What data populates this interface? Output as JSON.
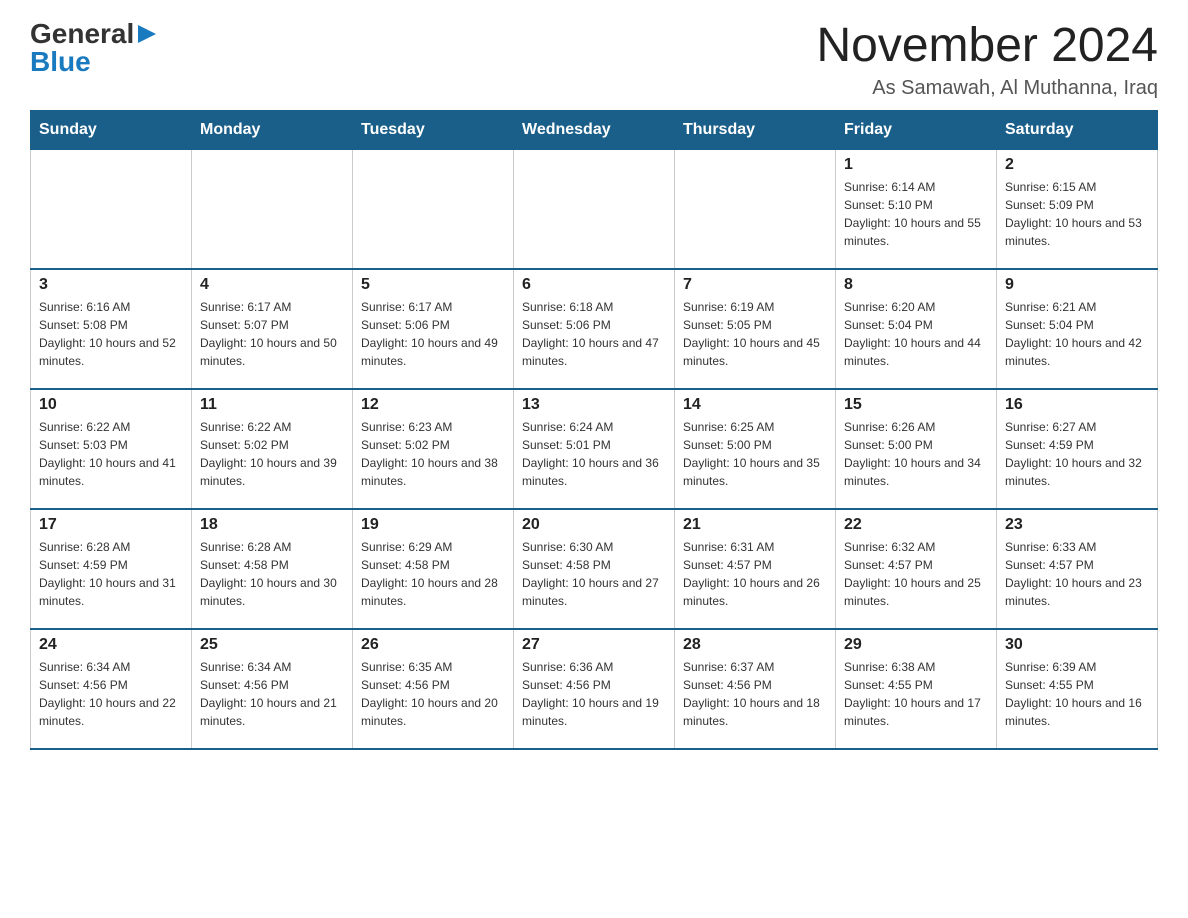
{
  "logo": {
    "general": "General",
    "blue": "Blue"
  },
  "title": "November 2024",
  "subtitle": "As Samawah, Al Muthanna, Iraq",
  "days_of_week": [
    "Sunday",
    "Monday",
    "Tuesday",
    "Wednesday",
    "Thursday",
    "Friday",
    "Saturday"
  ],
  "weeks": [
    [
      {
        "day": "",
        "sunrise": "",
        "sunset": "",
        "daylight": ""
      },
      {
        "day": "",
        "sunrise": "",
        "sunset": "",
        "daylight": ""
      },
      {
        "day": "",
        "sunrise": "",
        "sunset": "",
        "daylight": ""
      },
      {
        "day": "",
        "sunrise": "",
        "sunset": "",
        "daylight": ""
      },
      {
        "day": "",
        "sunrise": "",
        "sunset": "",
        "daylight": ""
      },
      {
        "day": "1",
        "sunrise": "Sunrise: 6:14 AM",
        "sunset": "Sunset: 5:10 PM",
        "daylight": "Daylight: 10 hours and 55 minutes."
      },
      {
        "day": "2",
        "sunrise": "Sunrise: 6:15 AM",
        "sunset": "Sunset: 5:09 PM",
        "daylight": "Daylight: 10 hours and 53 minutes."
      }
    ],
    [
      {
        "day": "3",
        "sunrise": "Sunrise: 6:16 AM",
        "sunset": "Sunset: 5:08 PM",
        "daylight": "Daylight: 10 hours and 52 minutes."
      },
      {
        "day": "4",
        "sunrise": "Sunrise: 6:17 AM",
        "sunset": "Sunset: 5:07 PM",
        "daylight": "Daylight: 10 hours and 50 minutes."
      },
      {
        "day": "5",
        "sunrise": "Sunrise: 6:17 AM",
        "sunset": "Sunset: 5:06 PM",
        "daylight": "Daylight: 10 hours and 49 minutes."
      },
      {
        "day": "6",
        "sunrise": "Sunrise: 6:18 AM",
        "sunset": "Sunset: 5:06 PM",
        "daylight": "Daylight: 10 hours and 47 minutes."
      },
      {
        "day": "7",
        "sunrise": "Sunrise: 6:19 AM",
        "sunset": "Sunset: 5:05 PM",
        "daylight": "Daylight: 10 hours and 45 minutes."
      },
      {
        "day": "8",
        "sunrise": "Sunrise: 6:20 AM",
        "sunset": "Sunset: 5:04 PM",
        "daylight": "Daylight: 10 hours and 44 minutes."
      },
      {
        "day": "9",
        "sunrise": "Sunrise: 6:21 AM",
        "sunset": "Sunset: 5:04 PM",
        "daylight": "Daylight: 10 hours and 42 minutes."
      }
    ],
    [
      {
        "day": "10",
        "sunrise": "Sunrise: 6:22 AM",
        "sunset": "Sunset: 5:03 PM",
        "daylight": "Daylight: 10 hours and 41 minutes."
      },
      {
        "day": "11",
        "sunrise": "Sunrise: 6:22 AM",
        "sunset": "Sunset: 5:02 PM",
        "daylight": "Daylight: 10 hours and 39 minutes."
      },
      {
        "day": "12",
        "sunrise": "Sunrise: 6:23 AM",
        "sunset": "Sunset: 5:02 PM",
        "daylight": "Daylight: 10 hours and 38 minutes."
      },
      {
        "day": "13",
        "sunrise": "Sunrise: 6:24 AM",
        "sunset": "Sunset: 5:01 PM",
        "daylight": "Daylight: 10 hours and 36 minutes."
      },
      {
        "day": "14",
        "sunrise": "Sunrise: 6:25 AM",
        "sunset": "Sunset: 5:00 PM",
        "daylight": "Daylight: 10 hours and 35 minutes."
      },
      {
        "day": "15",
        "sunrise": "Sunrise: 6:26 AM",
        "sunset": "Sunset: 5:00 PM",
        "daylight": "Daylight: 10 hours and 34 minutes."
      },
      {
        "day": "16",
        "sunrise": "Sunrise: 6:27 AM",
        "sunset": "Sunset: 4:59 PM",
        "daylight": "Daylight: 10 hours and 32 minutes."
      }
    ],
    [
      {
        "day": "17",
        "sunrise": "Sunrise: 6:28 AM",
        "sunset": "Sunset: 4:59 PM",
        "daylight": "Daylight: 10 hours and 31 minutes."
      },
      {
        "day": "18",
        "sunrise": "Sunrise: 6:28 AM",
        "sunset": "Sunset: 4:58 PM",
        "daylight": "Daylight: 10 hours and 30 minutes."
      },
      {
        "day": "19",
        "sunrise": "Sunrise: 6:29 AM",
        "sunset": "Sunset: 4:58 PM",
        "daylight": "Daylight: 10 hours and 28 minutes."
      },
      {
        "day": "20",
        "sunrise": "Sunrise: 6:30 AM",
        "sunset": "Sunset: 4:58 PM",
        "daylight": "Daylight: 10 hours and 27 minutes."
      },
      {
        "day": "21",
        "sunrise": "Sunrise: 6:31 AM",
        "sunset": "Sunset: 4:57 PM",
        "daylight": "Daylight: 10 hours and 26 minutes."
      },
      {
        "day": "22",
        "sunrise": "Sunrise: 6:32 AM",
        "sunset": "Sunset: 4:57 PM",
        "daylight": "Daylight: 10 hours and 25 minutes."
      },
      {
        "day": "23",
        "sunrise": "Sunrise: 6:33 AM",
        "sunset": "Sunset: 4:57 PM",
        "daylight": "Daylight: 10 hours and 23 minutes."
      }
    ],
    [
      {
        "day": "24",
        "sunrise": "Sunrise: 6:34 AM",
        "sunset": "Sunset: 4:56 PM",
        "daylight": "Daylight: 10 hours and 22 minutes."
      },
      {
        "day": "25",
        "sunrise": "Sunrise: 6:34 AM",
        "sunset": "Sunset: 4:56 PM",
        "daylight": "Daylight: 10 hours and 21 minutes."
      },
      {
        "day": "26",
        "sunrise": "Sunrise: 6:35 AM",
        "sunset": "Sunset: 4:56 PM",
        "daylight": "Daylight: 10 hours and 20 minutes."
      },
      {
        "day": "27",
        "sunrise": "Sunrise: 6:36 AM",
        "sunset": "Sunset: 4:56 PM",
        "daylight": "Daylight: 10 hours and 19 minutes."
      },
      {
        "day": "28",
        "sunrise": "Sunrise: 6:37 AM",
        "sunset": "Sunset: 4:56 PM",
        "daylight": "Daylight: 10 hours and 18 minutes."
      },
      {
        "day": "29",
        "sunrise": "Sunrise: 6:38 AM",
        "sunset": "Sunset: 4:55 PM",
        "daylight": "Daylight: 10 hours and 17 minutes."
      },
      {
        "day": "30",
        "sunrise": "Sunrise: 6:39 AM",
        "sunset": "Sunset: 4:55 PM",
        "daylight": "Daylight: 10 hours and 16 minutes."
      }
    ]
  ]
}
